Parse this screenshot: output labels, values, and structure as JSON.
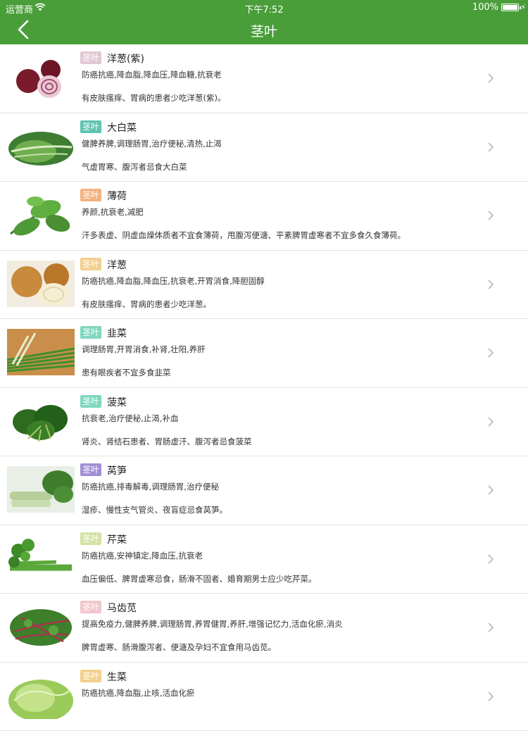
{
  "status_bar": {
    "carrier": "运营商",
    "time": "下午7:52",
    "battery": "100%"
  },
  "nav": {
    "title": "茎叶"
  },
  "items": [
    {
      "tag": "茎叶",
      "tag_color": "#e2c8d4",
      "name": "洋葱(紫)",
      "effect": "防癌抗癌,降血脂,降血压,降血糖,抗衰老",
      "taboo": "有皮肤瘙痒、胃病的患者少吃洋葱(紫)。",
      "image": "purple-onion-image"
    },
    {
      "tag": "茎叶",
      "tag_color": "#5ec4b1",
      "name": "大白菜",
      "effect": "健脾养脾,调理肠胃,治疗便秘,清热,止渴",
      "taboo": "气虚胃寒、腹泻者忌食大白菜",
      "image": "napa-cabbage-image"
    },
    {
      "tag": "茎叶",
      "tag_color": "#f4b282",
      "name": "薄荷",
      "effect": "养颜,抗衰老,减肥",
      "taboo": "汗多表虚、阴虚血燥体质者不宜食薄荷，甩腹泻便溏、平素脾胃虚寒者不宜多食久食薄荷。",
      "image": "mint-image"
    },
    {
      "tag": "茎叶",
      "tag_color": "#f3cf8c",
      "name": "洋葱",
      "effect": "防癌抗癌,降血脂,降血压,抗衰老,开胃消食,降胆固醇",
      "taboo": "有皮肤瘙痒、胃病的患者少吃洋葱。",
      "image": "onion-image"
    },
    {
      "tag": "茎叶",
      "tag_color": "#7fd7bf",
      "name": "韭菜",
      "effect": "调理肠胃,开胃消食,补肾,壮阳,养肝",
      "taboo": "患有眼疾者不宜多食韭菜",
      "image": "chives-image"
    },
    {
      "tag": "茎叶",
      "tag_color": "#7fd7bf",
      "name": "菠菜",
      "effect": "抗衰老,治疗便秘,止渴,补血",
      "taboo": "肾炎、肾结石患者、胃肠虚汗、腹泻者忌食菠菜",
      "image": "spinach-image"
    },
    {
      "tag": "茎叶",
      "tag_color": "#a08fd6",
      "name": "莴笋",
      "effect": "防癌抗癌,排毒解毒,调理肠胃,治疗便秘",
      "taboo": "湿疹、慢性支气管炎、夜盲症忌食莴笋。",
      "image": "lettuce-stem-image"
    },
    {
      "tag": "茎叶",
      "tag_color": "#d3e2a6",
      "name": "芹菜",
      "effect": "防癌抗癌,安神镇定,降血压,抗衰老",
      "taboo": "血压偏低、脾胃虚寒忌食，肠滑不固者、婚育期男士应少吃芹菜。",
      "image": "celery-image"
    },
    {
      "tag": "茎叶",
      "tag_color": "#f2c6cd",
      "name": "马齿苋",
      "effect": "提高免疫力,健脾养脾,调理肠胃,养胃健胃,养肝,增强记忆力,活血化瘀,消炎",
      "taboo": "脾胃虚寒、肠滑腹泻者、便溏及孕妇不宜食用马齿苋。",
      "image": "purslane-image"
    },
    {
      "tag": "茎叶",
      "tag_color": "#f3cf8c",
      "name": "生菜",
      "effect": "防癌抗癌,降血脂,止咳,活血化瘀",
      "taboo": "",
      "image": "lettuce-image"
    }
  ]
}
